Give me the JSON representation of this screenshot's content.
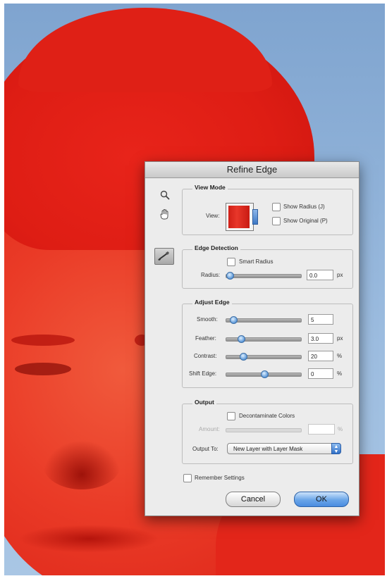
{
  "dialog": {
    "title": "Refine Edge",
    "view_mode": {
      "section_title": "View Mode",
      "view_label": "View:",
      "show_radius_label": "Show Radius (J)",
      "show_original_label": "Show Original (P)"
    },
    "edge_detection": {
      "section_title": "Edge Detection",
      "smart_radius_label": "Smart Radius",
      "radius_label": "Radius:",
      "radius_value": "0.0",
      "radius_unit": "px",
      "radius_slider_fraction": 0.0
    },
    "adjust_edge": {
      "section_title": "Adjust Edge",
      "smooth_label": "Smooth:",
      "smooth_value": "5",
      "smooth_slider_fraction": 0.05,
      "feather_label": "Feather:",
      "feather_value": "3.0",
      "feather_unit": "px",
      "feather_slider_fraction": 0.16,
      "contrast_label": "Contrast:",
      "contrast_value": "20",
      "contrast_unit": "%",
      "contrast_slider_fraction": 0.2,
      "shift_edge_label": "Shift Edge:",
      "shift_edge_value": "0",
      "shift_edge_unit": "%",
      "shift_edge_slider_fraction": 0.5
    },
    "output": {
      "section_title": "Output",
      "decontaminate_label": "Decontaminate Colors",
      "amount_label": "Amount:",
      "amount_value": "",
      "amount_unit": "%",
      "output_to_label": "Output To:",
      "output_to_value": "New Layer with Layer Mask"
    },
    "remember_settings_label": "Remember Settings",
    "cancel_label": "Cancel",
    "ok_label": "OK"
  },
  "icons": {
    "zoom": "zoom-icon",
    "hand": "hand-icon",
    "refine_brush": "refine-radius-brush-icon"
  }
}
